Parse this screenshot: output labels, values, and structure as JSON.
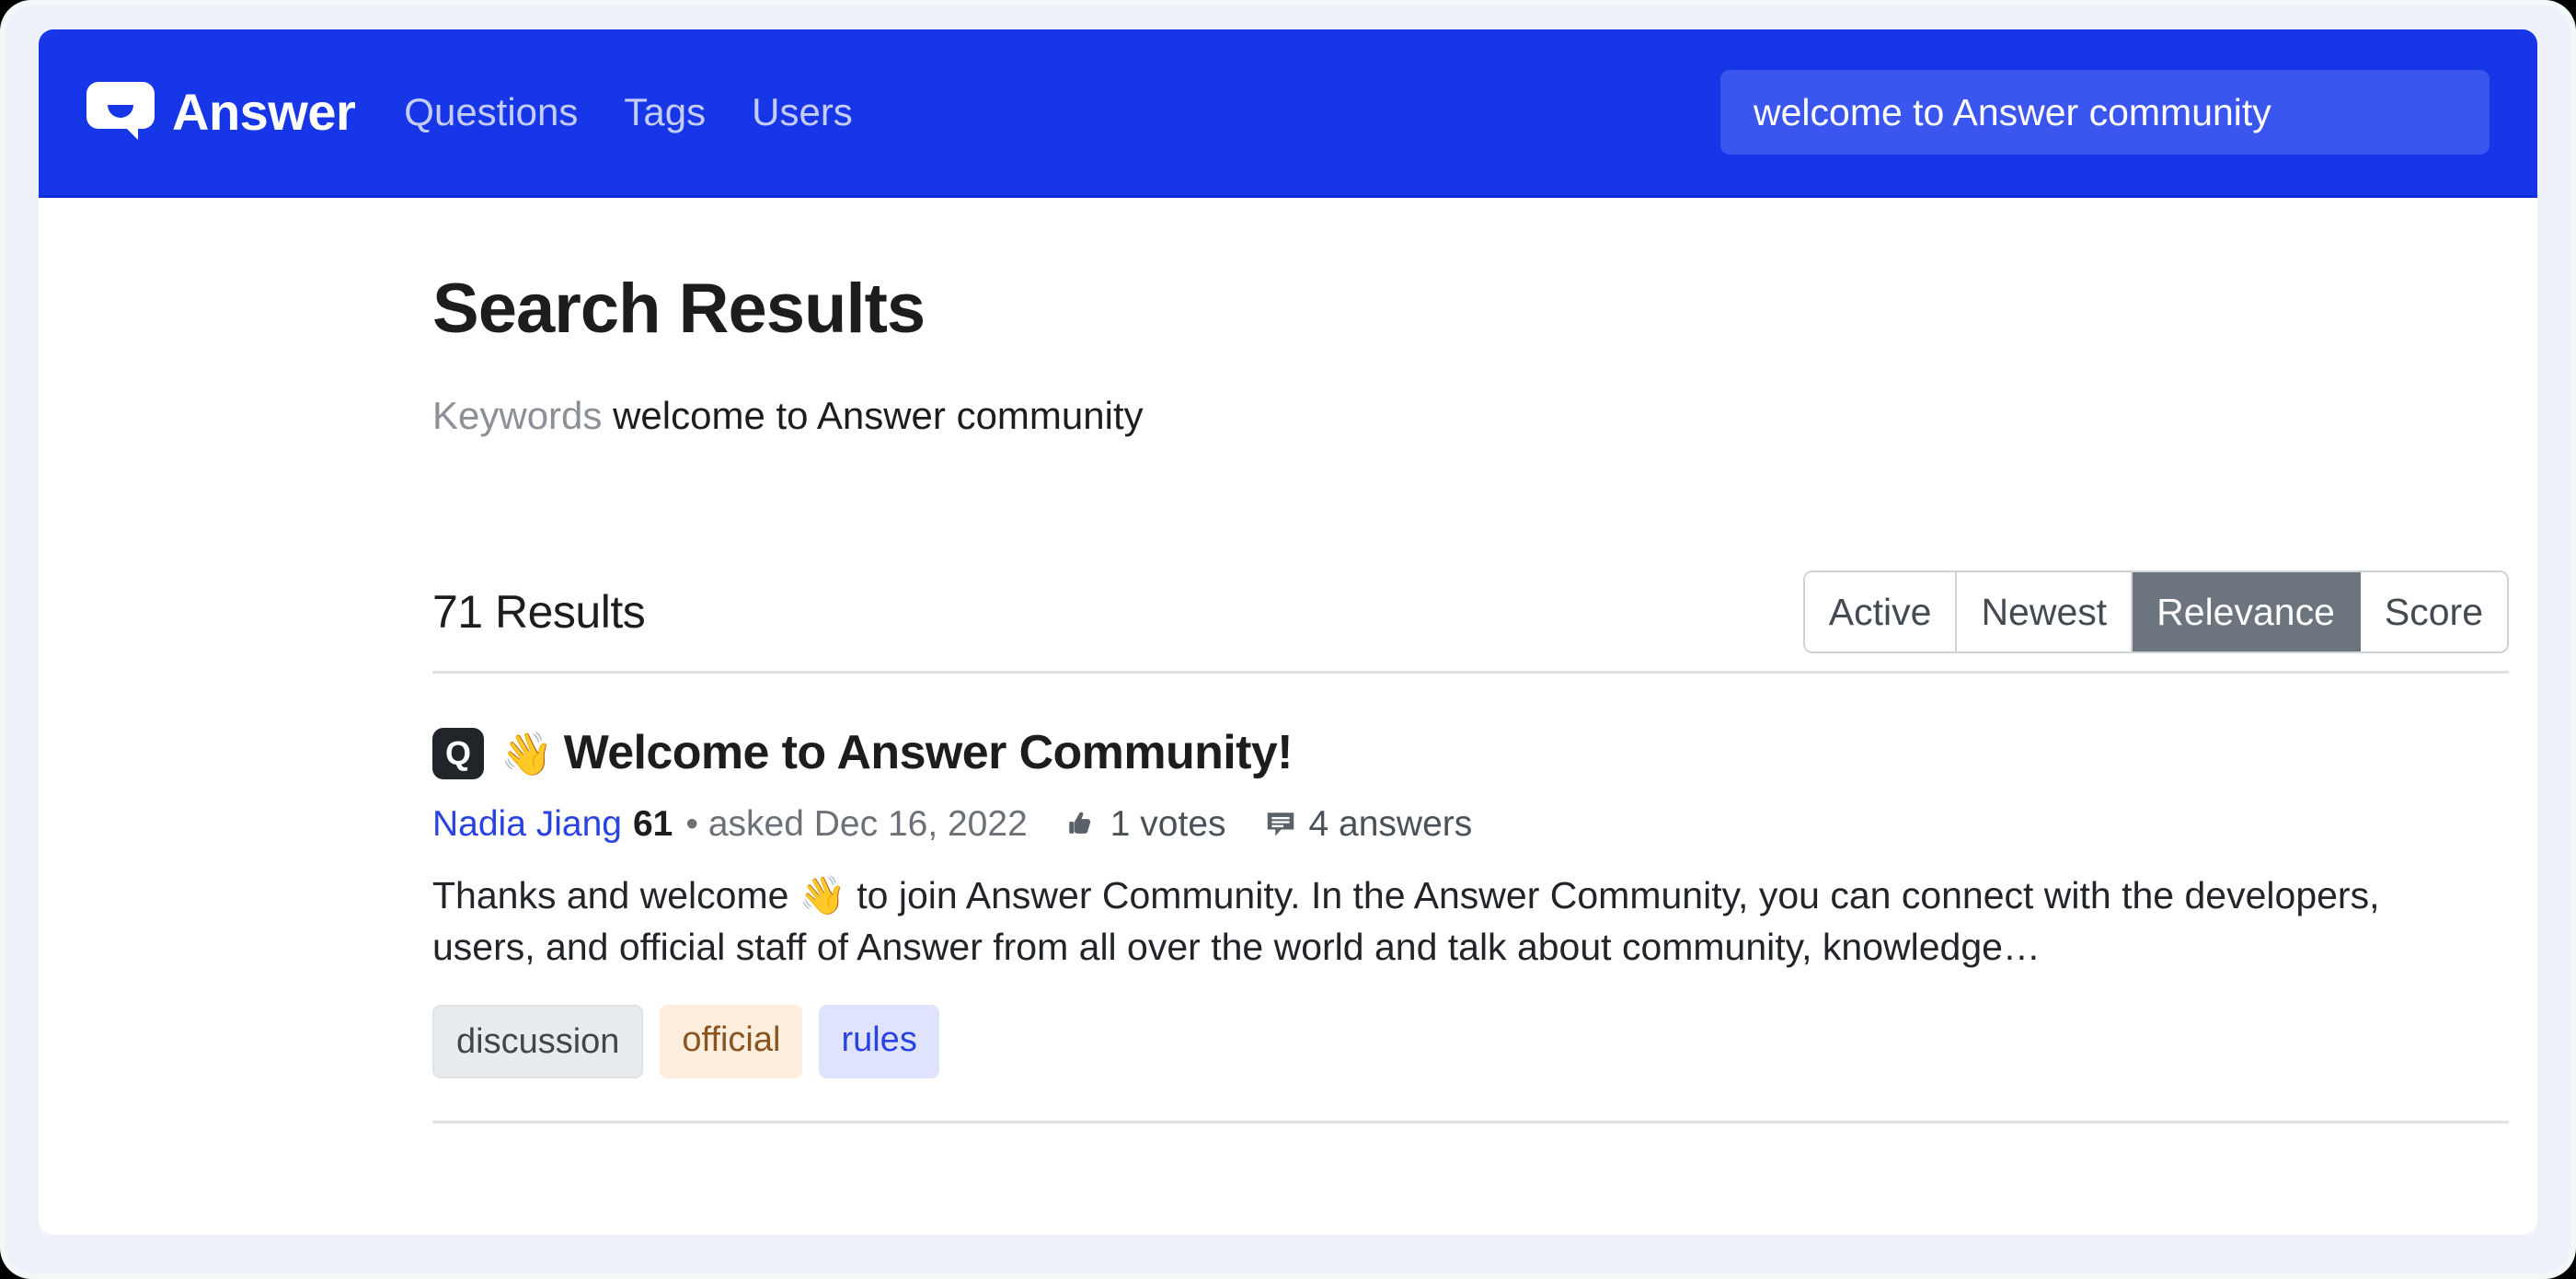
{
  "header": {
    "brand_name": "Answer",
    "logo_icon": "answer-speech-bubble-logo",
    "nav_links": [
      {
        "label": "Questions",
        "name": "questions"
      },
      {
        "label": "Tags",
        "name": "tags"
      },
      {
        "label": "Users",
        "name": "users"
      }
    ],
    "search": {
      "value": "welcome to Answer community",
      "placeholder": "Search",
      "icon": "search-icon"
    },
    "colors": {
      "background": "#1736e8",
      "search_background": "#3a56ef",
      "nav_link": "#c3cdf7"
    }
  },
  "main": {
    "title": "Search Results",
    "keywords_label": "Keywords",
    "keywords_value": "welcome to Answer community",
    "results_count_text": "71 Results",
    "sort_options": [
      {
        "label": "Active",
        "active": false
      },
      {
        "label": "Newest",
        "active": false
      },
      {
        "label": "Relevance",
        "active": true
      },
      {
        "label": "Score",
        "active": false
      }
    ],
    "sort_active_color": "#6c757d",
    "results": [
      {
        "badge": "Q",
        "title_emoji": "👋",
        "title": "Welcome to Answer Community!",
        "author": "Nadia Jiang",
        "reputation": "61",
        "asked_text": "• asked Dec 16, 2022",
        "votes_icon": "thumbs-up-icon",
        "votes_text": "1 votes",
        "answers_icon": "comment-icon",
        "answers_text": "4 answers",
        "excerpt": "Thanks and welcome 👋 to join Answer Community.  In the Answer Community, you can connect with the developers, users, and official staff of Answer from all over the world and talk about community, knowledge…",
        "tags": [
          {
            "label": "discussion",
            "style": "discussion"
          },
          {
            "label": "official",
            "style": "official"
          },
          {
            "label": "rules",
            "style": "rules"
          }
        ]
      }
    ]
  }
}
